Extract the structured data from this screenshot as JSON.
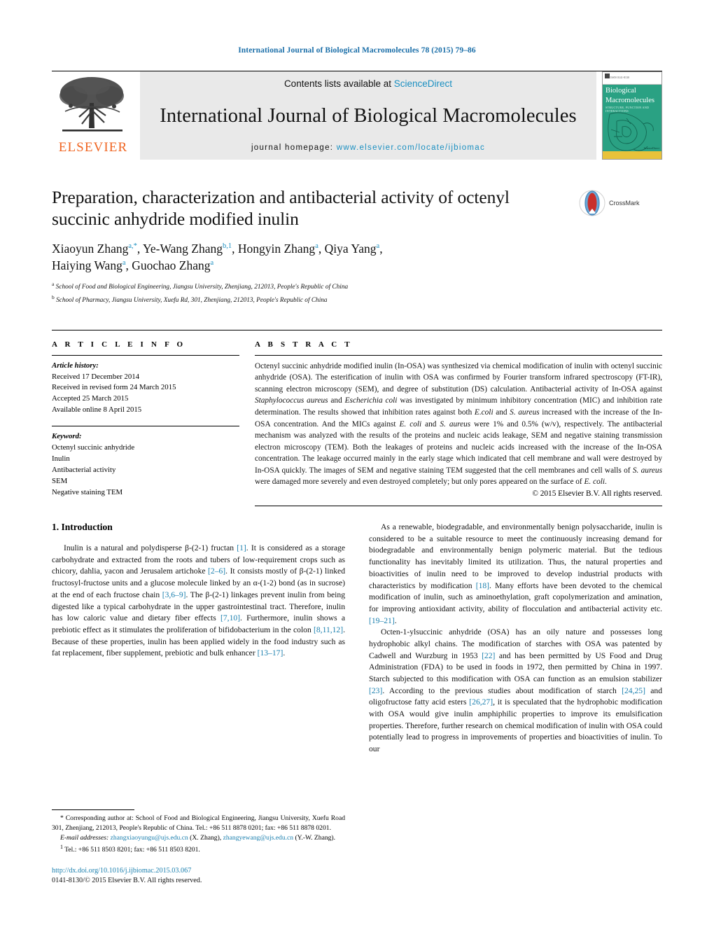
{
  "running_head": "International Journal of Biological Macromolecules 78 (2015) 79–86",
  "masthead": {
    "contents_prefix": "Contents lists available at ",
    "sciencedirect": "ScienceDirect",
    "journal_title": "International Journal of Biological Macromolecules",
    "homepage_prefix": "journal homepage: ",
    "homepage_url": "www.elsevier.com/locate/ijbiomac",
    "publisher_logo": "ELSEVIER",
    "cover": {
      "line1": "Biological",
      "line2": "Macromolecules",
      "sub": "STRUCTURE, FUNCTION AND INTERACTIONS",
      "top_note": "ISSN 0141-8130",
      "badge": "ScienceDirect"
    },
    "colors": {
      "link": "#1a8fc1",
      "elsevier_orange": "#f06522",
      "cover_green": "#2aa183",
      "cover_yellow": "#e8c23a"
    }
  },
  "article": {
    "title": "Preparation, characterization and antibacterial activity of octenyl succinic anhydride modified inulin",
    "authors_line1_parts": [
      {
        "name": "Xiaoyun Zhang",
        "sup": "a,*"
      },
      {
        "name": "Ye-Wang Zhang",
        "sup": "b,1"
      },
      {
        "name": "Hongyin Zhang",
        "sup": "a"
      },
      {
        "name": "Qiya Yang",
        "sup": "a"
      }
    ],
    "authors_line2_parts": [
      {
        "name": "Haiying Wang",
        "sup": "a"
      },
      {
        "name": "Guochao Zhang",
        "sup": "a"
      }
    ],
    "affiliation_a_marker": "a",
    "affiliation_a": "School of Food and Biological Engineering, Jiangsu University, Zhenjiang, 212013, People's Republic of China",
    "affiliation_b_marker": "b",
    "affiliation_b": "School of Pharmacy, Jiangsu University, Xuefu Rd, 301, Zhenjiang, 212013, People's Republic of China",
    "crossmark_label": "CrossMark"
  },
  "article_info": {
    "heading": "A R T I C L E   I N F O",
    "history_head": "Article history:",
    "history": [
      "Received 17 December 2014",
      "Received in revised form 24 March 2015",
      "Accepted 25 March 2015",
      "Available online 8 April 2015"
    ],
    "keyword_head": "Keyword:",
    "keywords": [
      "Octenyl succinic anhydride",
      "Inulin",
      "Antibacterial activity",
      "SEM",
      "Negative staining TEM"
    ]
  },
  "abstract": {
    "heading": "A B S T R A C T",
    "copyright": "© 2015 Elsevier B.V. All rights reserved."
  },
  "introduction": {
    "heading": "1.  Introduction",
    "left_p1_before": "Inulin is a natural and polydisperse β-(2-1) fructan ",
    "left_p1_ref1": "[1]",
    "left_p1_mid1": ". It is considered as a storage carbohydrate and extracted from the roots and tubers of low-requirement crops such as chicory, dahlia, yacon and Jerusalem artichoke ",
    "left_p1_ref2": "[2–6]",
    "left_p1_mid2": ". It consists mostly of β-(2-1) linked fructosyl-fructose units and a glucose molecule linked by an α-(1-2) bond (as in sucrose) at the end of each fructose chain ",
    "left_p1_ref3": "[3,6–9]",
    "left_p1_mid3": ". The β-(2-1) linkages prevent inulin from being digested like a typical carbohydrate in the upper gastrointestinal tract. Therefore, inulin has low caloric value and dietary fiber effects ",
    "left_p1_ref4": "[7,10]",
    "left_p1_mid4": ". Furthermore, inulin shows a prebiotic effect as it stimulates the proliferation of bifidobacterium in the colon ",
    "left_p1_ref5": "[8,11,12]",
    "left_p1_mid5": ". Because of these properties, inulin has been applied widely in the food industry such as fat replacement, fiber supplement, prebiotic and bulk enhancer ",
    "left_p1_ref6": "[13–17]",
    "left_p1_end": ".",
    "right_p1_before": "As a renewable, biodegradable, and environmentally benign polysaccharide, inulin is considered to be a suitable resource to meet the continuously increasing demand for biodegradable and environmentally benign polymeric material. But the tedious functionality has inevitably limited its utilization. Thus, the natural properties and bioactivities of inulin need to be improved to develop industrial products with characteristics by modification ",
    "right_p1_ref1": "[18]",
    "right_p1_mid1": ". Many efforts have been devoted to the chemical modification of inulin, such as aminoethylation, graft copolymerization and amination, for improving antioxidant activity, ability of flocculation and antibacterial activity etc. ",
    "right_p1_ref2": "[19–21]",
    "right_p1_end": ".",
    "right_p2_before": "Octen-1-ylsuccinic anhydride (OSA) has an oily nature and possesses long hydrophobic alkyl chains. The modification of starches with OSA was patented by Cadwell and Wurzburg in 1953 ",
    "right_p2_ref1": "[22]",
    "right_p2_mid1": " and has been permitted by US Food and Drug Administration (FDA) to be used in foods in 1972, then permitted by China in 1997. Starch subjected to this modification with OSA can function as an emulsion stabilizer ",
    "right_p2_ref2": "[23]",
    "right_p2_mid2": ". According to the previous studies about modification of starch ",
    "right_p2_ref3": "[24,25]",
    "right_p2_mid3": " and oligofructose fatty acid esters ",
    "right_p2_ref4": "[26,27]",
    "right_p2_end": ", it is speculated that the hydrophobic modification with OSA would give inulin amphiphilic properties to improve its emulsification properties. Therefore, further research on chemical modification of inulin with OSA could potentially lead to progress in improvements of properties and bioactivities of inulin. To our"
  },
  "footnotes": {
    "corresponding_marker": "*",
    "corresponding": " Corresponding author at: School of Food and Biological Engineering, Jiangsu University, Xuefu Road 301, Zhenjiang, 212013, People's Republic of China. Tel.: +86 511 8878 0201; fax: +86 511 8878 0201.",
    "email_label": "E-mail addresses:",
    "email1": "zhangxiaoyungu@ujs.edu.cn",
    "email1_owner": " (X. Zhang),",
    "email2": "zhangyewang@ujs.edu.cn",
    "email2_owner": " (Y.-W. Zhang).",
    "note1_marker": "1",
    "note1": " Tel.: +86 511 8503 8201; fax: +86 511 8503 8201.",
    "doi": "http://dx.doi.org/10.1016/j.ijbiomac.2015.03.067",
    "issn": "0141-8130/© 2015 Elsevier B.V. All rights reserved."
  }
}
